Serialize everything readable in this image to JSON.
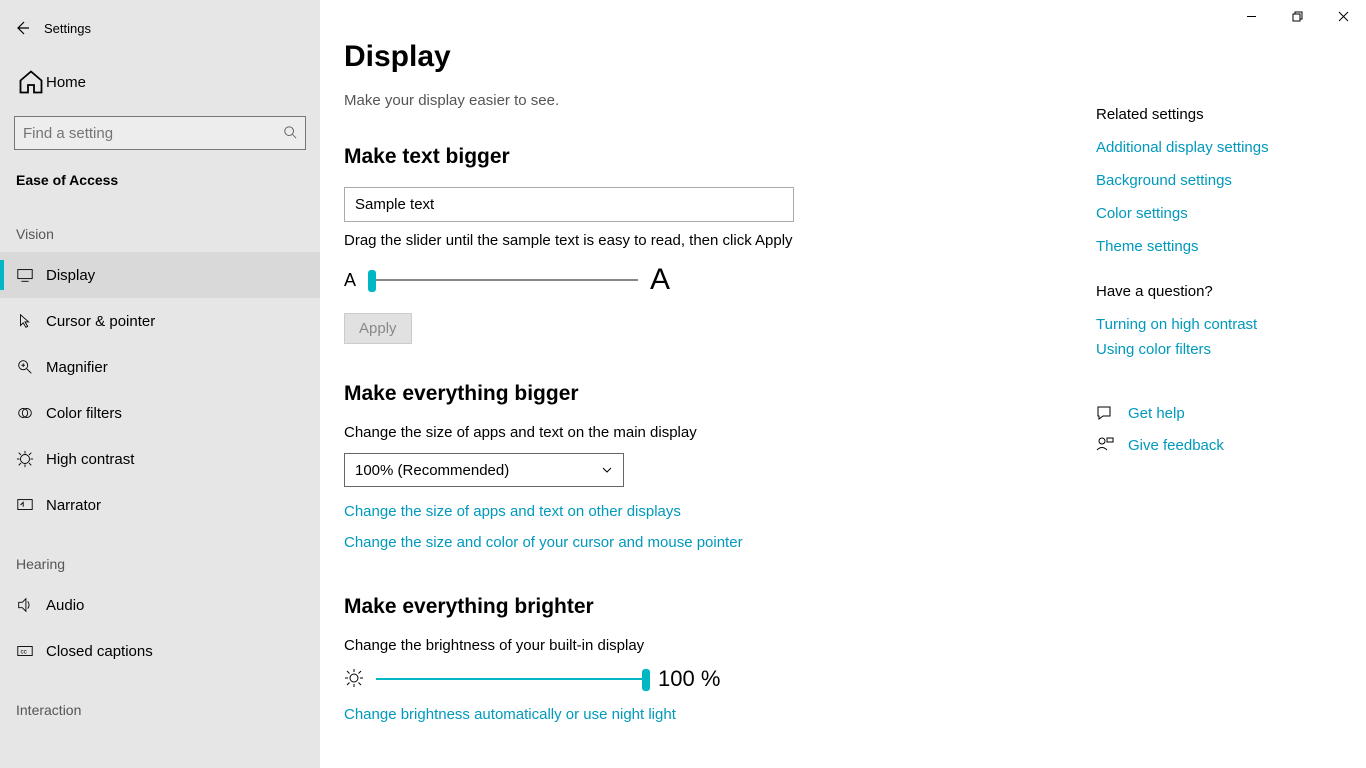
{
  "app_title": "Settings",
  "home_label": "Home",
  "search_placeholder": "Find a setting",
  "category": "Ease of Access",
  "groups": {
    "vision": "Vision",
    "hearing": "Hearing",
    "interaction": "Interaction"
  },
  "nav": {
    "display": "Display",
    "cursor": "Cursor & pointer",
    "magnifier": "Magnifier",
    "color_filters": "Color filters",
    "high_contrast": "High contrast",
    "narrator": "Narrator",
    "audio": "Audio",
    "closed_captions": "Closed captions"
  },
  "page": {
    "title": "Display",
    "subtitle": "Make your display easier to see."
  },
  "text_bigger": {
    "heading": "Make text bigger",
    "sample": "Sample text",
    "slider_desc": "Drag the slider until the sample text is easy to read, then click Apply",
    "small_a": "A",
    "big_a": "A",
    "apply": "Apply"
  },
  "everything_bigger": {
    "heading": "Make everything bigger",
    "desc": "Change the size of apps and text on the main display",
    "dropdown_value": "100% (Recommended)",
    "link_other_displays": "Change the size of apps and text on other displays",
    "link_cursor": "Change the size and color of your cursor and mouse pointer"
  },
  "brighter": {
    "heading": "Make everything brighter",
    "desc": "Change the brightness of your built-in display",
    "value": "100 %",
    "link_auto": "Change brightness automatically or use night light"
  },
  "right": {
    "related_hdr": "Related settings",
    "links": {
      "additional_display": "Additional display settings",
      "background": "Background settings",
      "color": "Color settings",
      "theme": "Theme settings"
    },
    "question_hdr": "Have a question?",
    "q_links": {
      "high_contrast": "Turning on high contrast",
      "color_filters": "Using color filters"
    },
    "help": "Get help",
    "feedback": "Give feedback"
  }
}
